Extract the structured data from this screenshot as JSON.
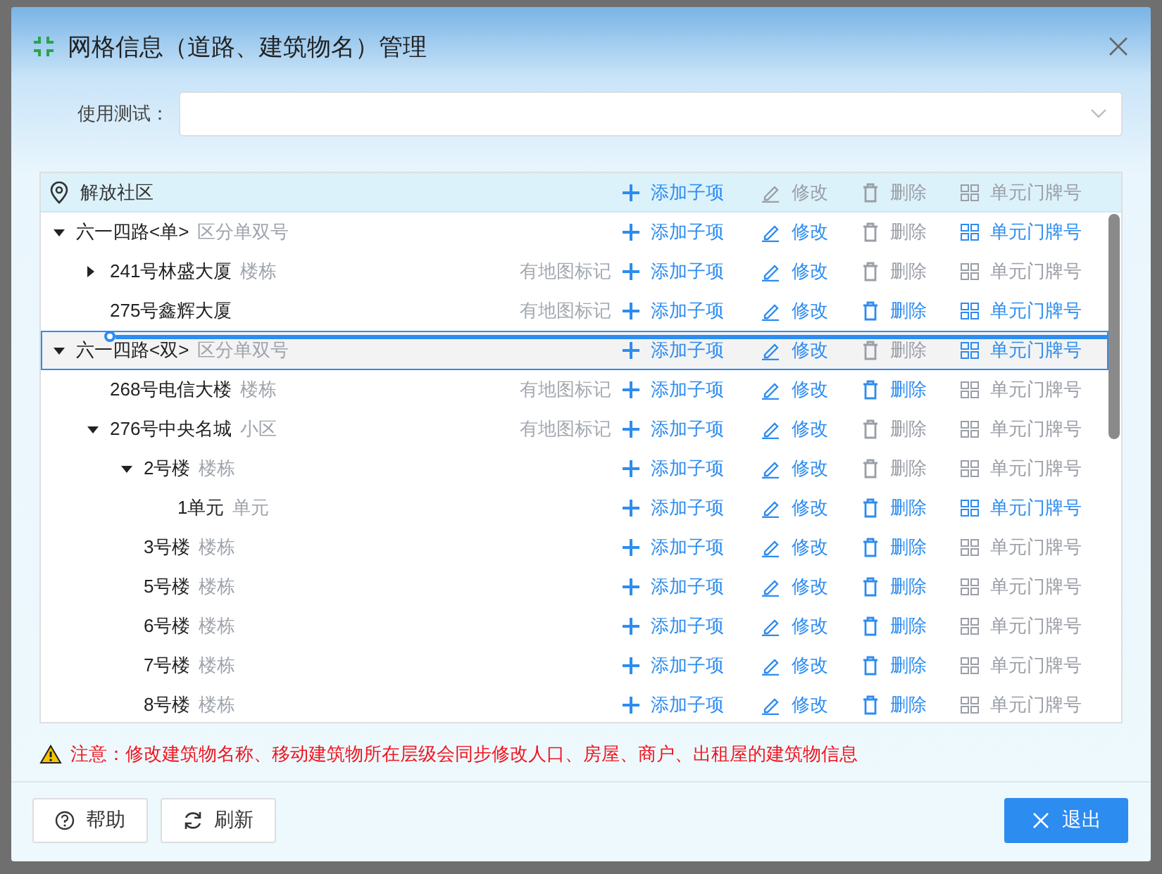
{
  "window": {
    "title": "网格信息（道路、建筑物名）管理"
  },
  "field": {
    "label": "使用测试："
  },
  "tree": {
    "root": {
      "name": "解放社区",
      "actions": [
        {
          "kind": "add",
          "label": "添加子项",
          "disabled": false
        },
        {
          "kind": "edit",
          "label": "修改",
          "disabled": true
        },
        {
          "kind": "delete",
          "label": "删除",
          "disabled": true
        },
        {
          "kind": "unit",
          "label": "单元门牌号",
          "disabled": true
        }
      ]
    },
    "rows": [
      {
        "name": "六一四路<单>",
        "type": "区分单双号",
        "expanded": true,
        "selected": false,
        "drop_target": false,
        "actions": [
          {
            "kind": "add",
            "label": "添加子项",
            "disabled": false
          },
          {
            "kind": "edit",
            "label": "修改",
            "disabled": false
          },
          {
            "kind": "delete",
            "label": "删除",
            "disabled": true
          },
          {
            "kind": "unit",
            "label": "单元门牌号",
            "disabled": false
          }
        ],
        "children": [
          {
            "name": "241号林盛大厦",
            "type": "楼栋",
            "map_mark": "有地图标记",
            "expanded": false,
            "selected": false,
            "drop_target": false,
            "actions": [
              {
                "kind": "add",
                "label": "添加子项",
                "disabled": false
              },
              {
                "kind": "edit",
                "label": "修改",
                "disabled": false
              },
              {
                "kind": "delete",
                "label": "删除",
                "disabled": true
              },
              {
                "kind": "unit",
                "label": "单元门牌号",
                "disabled": true
              }
            ]
          },
          {
            "name": "275号鑫辉大厦",
            "map_mark": "有地图标记",
            "selected": false,
            "drop_target": false,
            "actions": [
              {
                "kind": "add",
                "label": "添加子项",
                "disabled": false
              },
              {
                "kind": "edit",
                "label": "修改",
                "disabled": false
              },
              {
                "kind": "delete",
                "label": "删除",
                "disabled": false
              },
              {
                "kind": "unit",
                "label": "单元门牌号",
                "disabled": false
              }
            ]
          }
        ]
      },
      {
        "name": "六一四路<双>",
        "type": "区分单双号",
        "expanded": true,
        "selected": true,
        "drop_target": true,
        "actions": [
          {
            "kind": "add",
            "label": "添加子项",
            "disabled": false
          },
          {
            "kind": "edit",
            "label": "修改",
            "disabled": false
          },
          {
            "kind": "delete",
            "label": "删除",
            "disabled": true
          },
          {
            "kind": "unit",
            "label": "单元门牌号",
            "disabled": false
          }
        ],
        "children": [
          {
            "name": "268号电信大楼",
            "type": "楼栋",
            "map_mark": "有地图标记",
            "selected": false,
            "drop_target": false,
            "actions": [
              {
                "kind": "add",
                "label": "添加子项",
                "disabled": false
              },
              {
                "kind": "edit",
                "label": "修改",
                "disabled": false
              },
              {
                "kind": "delete",
                "label": "删除",
                "disabled": false
              },
              {
                "kind": "unit",
                "label": "单元门牌号",
                "disabled": true
              }
            ]
          },
          {
            "name": "276号中央名城",
            "type": "小区",
            "map_mark": "有地图标记",
            "expanded": true,
            "selected": false,
            "drop_target": false,
            "actions": [
              {
                "kind": "add",
                "label": "添加子项",
                "disabled": false
              },
              {
                "kind": "edit",
                "label": "修改",
                "disabled": false
              },
              {
                "kind": "delete",
                "label": "删除",
                "disabled": true
              },
              {
                "kind": "unit",
                "label": "单元门牌号",
                "disabled": true
              }
            ],
            "children": [
              {
                "name": "2号楼",
                "type": "楼栋",
                "expanded": true,
                "selected": false,
                "drop_target": false,
                "actions": [
                  {
                    "kind": "add",
                    "label": "添加子项",
                    "disabled": false
                  },
                  {
                    "kind": "edit",
                    "label": "修改",
                    "disabled": false
                  },
                  {
                    "kind": "delete",
                    "label": "删除",
                    "disabled": true
                  },
                  {
                    "kind": "unit",
                    "label": "单元门牌号",
                    "disabled": true
                  }
                ],
                "children": [
                  {
                    "name": "1单元",
                    "type": "单元",
                    "selected": false,
                    "drop_target": false,
                    "actions": [
                      {
                        "kind": "add",
                        "label": "添加子项",
                        "disabled": false
                      },
                      {
                        "kind": "edit",
                        "label": "修改",
                        "disabled": false
                      },
                      {
                        "kind": "delete",
                        "label": "删除",
                        "disabled": false
                      },
                      {
                        "kind": "unit",
                        "label": "单元门牌号",
                        "disabled": false
                      }
                    ]
                  }
                ]
              },
              {
                "name": "3号楼",
                "type": "楼栋",
                "selected": false,
                "drop_target": false,
                "actions": [
                  {
                    "kind": "add",
                    "label": "添加子项",
                    "disabled": false
                  },
                  {
                    "kind": "edit",
                    "label": "修改",
                    "disabled": false
                  },
                  {
                    "kind": "delete",
                    "label": "删除",
                    "disabled": false
                  },
                  {
                    "kind": "unit",
                    "label": "单元门牌号",
                    "disabled": true
                  }
                ]
              },
              {
                "name": "5号楼",
                "type": "楼栋",
                "selected": false,
                "drop_target": false,
                "actions": [
                  {
                    "kind": "add",
                    "label": "添加子项",
                    "disabled": false
                  },
                  {
                    "kind": "edit",
                    "label": "修改",
                    "disabled": false
                  },
                  {
                    "kind": "delete",
                    "label": "删除",
                    "disabled": false
                  },
                  {
                    "kind": "unit",
                    "label": "单元门牌号",
                    "disabled": true
                  }
                ]
              },
              {
                "name": "6号楼",
                "type": "楼栋",
                "selected": false,
                "drop_target": false,
                "actions": [
                  {
                    "kind": "add",
                    "label": "添加子项",
                    "disabled": false
                  },
                  {
                    "kind": "edit",
                    "label": "修改",
                    "disabled": false
                  },
                  {
                    "kind": "delete",
                    "label": "删除",
                    "disabled": false
                  },
                  {
                    "kind": "unit",
                    "label": "单元门牌号",
                    "disabled": true
                  }
                ]
              },
              {
                "name": "7号楼",
                "type": "楼栋",
                "selected": false,
                "drop_target": false,
                "actions": [
                  {
                    "kind": "add",
                    "label": "添加子项",
                    "disabled": false
                  },
                  {
                    "kind": "edit",
                    "label": "修改",
                    "disabled": false
                  },
                  {
                    "kind": "delete",
                    "label": "删除",
                    "disabled": false
                  },
                  {
                    "kind": "unit",
                    "label": "单元门牌号",
                    "disabled": true
                  }
                ]
              },
              {
                "name": "8号楼",
                "type": "楼栋",
                "selected": false,
                "drop_target": false,
                "actions": [
                  {
                    "kind": "add",
                    "label": "添加子项",
                    "disabled": false
                  },
                  {
                    "kind": "edit",
                    "label": "修改",
                    "disabled": false
                  },
                  {
                    "kind": "delete",
                    "label": "删除",
                    "disabled": false
                  },
                  {
                    "kind": "unit",
                    "label": "单元门牌号",
                    "disabled": true
                  }
                ]
              }
            ]
          }
        ]
      }
    ]
  },
  "warning": "注意：修改建筑物名称、移动建筑物所在层级会同步修改人口、房屋、商户、出租屋的建筑物信息",
  "buttons": [
    {
      "kind": "help",
      "label": "帮助"
    },
    {
      "kind": "refresh",
      "label": "刷新"
    },
    {
      "kind": "exit",
      "label": "退出"
    }
  ]
}
